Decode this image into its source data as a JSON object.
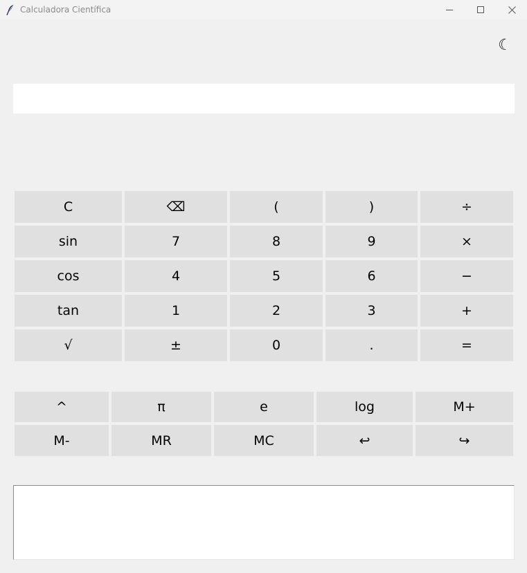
{
  "window": {
    "title": "Calculadora Científica",
    "app_icon": "feather-icon",
    "controls": [
      "minimize-icon",
      "maximize-icon",
      "close-icon"
    ]
  },
  "theme_toggle": {
    "glyph": "☾",
    "icon": "moon-icon"
  },
  "display": {
    "value": "",
    "placeholder": ""
  },
  "keypad_main": {
    "rows": [
      [
        "C",
        "⌫",
        "(",
        ")",
        "÷"
      ],
      [
        "sin",
        "7",
        "8",
        "9",
        "×"
      ],
      [
        "cos",
        "4",
        "5",
        "6",
        "−"
      ],
      [
        "tan",
        "1",
        "2",
        "3",
        "+"
      ],
      [
        "√",
        "±",
        "0",
        ".",
        "="
      ]
    ]
  },
  "keypad_extra": {
    "rows": [
      [
        "^",
        "π",
        "e",
        "log",
        "M+"
      ],
      [
        "M-",
        "MR",
        "MC",
        "↩",
        "↪"
      ]
    ]
  },
  "history": {
    "value": ""
  },
  "colors": {
    "window_bg": "#f0f0f0",
    "titlebar_bg": "#f3f3f3",
    "key_bg": "#e0e0e0",
    "field_bg": "#ffffff",
    "text": "#000000",
    "title_text": "#8a8a8a"
  }
}
